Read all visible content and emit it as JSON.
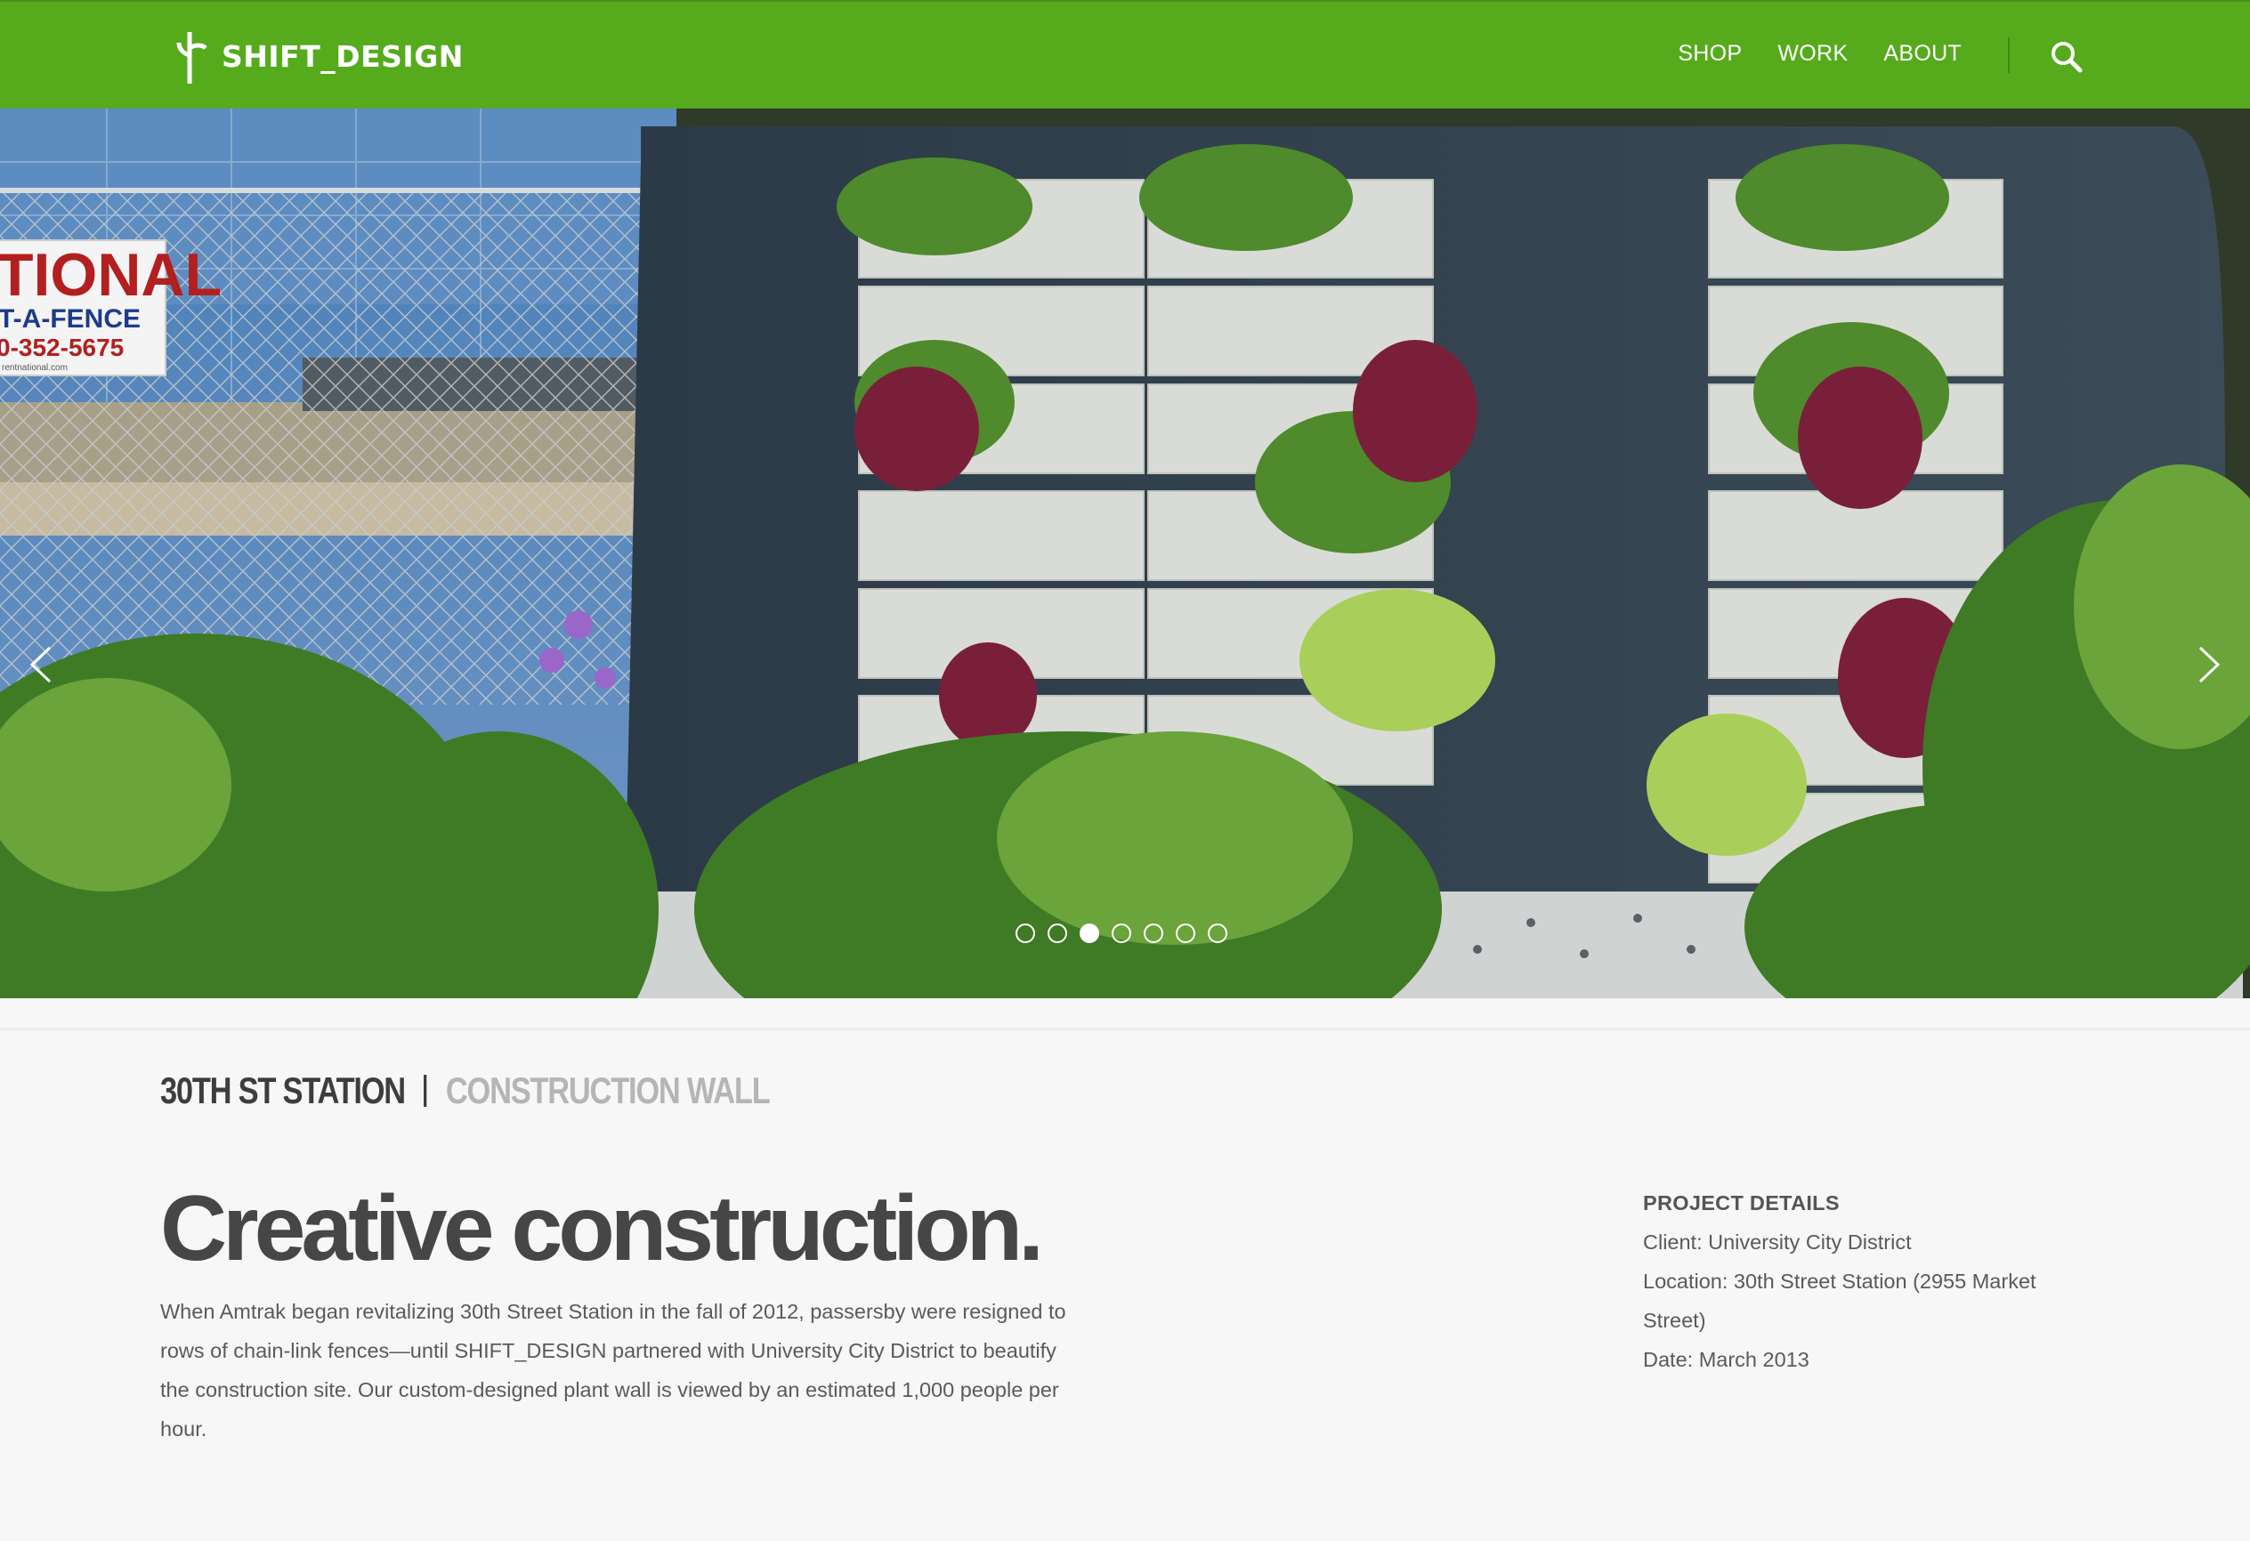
{
  "header": {
    "brand": "SHIFT_DESIGN",
    "nav": [
      "SHOP",
      "WORK",
      "ABOUT"
    ],
    "accent_color": "#56ab1d",
    "search_icon": "search-icon"
  },
  "hero": {
    "sign_lines": [
      "TIONAL",
      "T-A-FENCE",
      "0-352-5675",
      "rentnational.com"
    ],
    "slides_total": 7,
    "active_slide": 3,
    "prev_icon": "chevron-left-icon",
    "next_icon": "chevron-right-icon"
  },
  "project": {
    "name": "30TH ST STATION",
    "category": "CONSTRUCTION WALL",
    "headline": "Creative construction.",
    "description_lines": [
      "When Amtrak began revitalizing 30th Street Station in the fall of 2012, passersby were resigned to",
      "rows of chain-link fences—until SHIFT_DESIGN partnered with University City District to beautify",
      "the construction site. Our custom-designed plant wall is viewed by an estimated 1,000 people per",
      "hour."
    ]
  },
  "details": {
    "title": "PROJECT DETAILS",
    "lines": [
      "Client: University City District",
      "Location: 30th Street Station (2955 Market",
      "Street)",
      "Date: March 2013"
    ]
  }
}
